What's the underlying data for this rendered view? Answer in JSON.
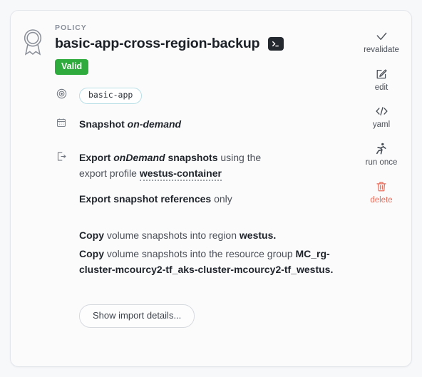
{
  "card": {
    "eyebrow": "POLICY",
    "title": "basic-app-cross-region-backup",
    "terminal_icon": "terminal-icon",
    "award_icon": "award-ribbon-icon",
    "status_badge": {
      "label": "Valid",
      "color": "#2eab3c"
    },
    "target": {
      "icon": "target-icon",
      "chip_label": "basic-app"
    },
    "snapshot": {
      "icon": "calendar-icon",
      "label": "Snapshot",
      "value": "on-demand"
    },
    "export": {
      "icon": "export-icon",
      "line1_a": "Export",
      "line1_b": "onDemand",
      "line1_c": "snapshots",
      "line1_d": "using the",
      "line2_a": "export profile",
      "line2_b": "westus-container",
      "line3_a": "Export snapshot references",
      "line3_b": "only"
    },
    "copy": [
      {
        "verb": "Copy",
        "mid": "volume snapshots into region",
        "target": "westus",
        "period": "."
      },
      {
        "verb": "Copy",
        "mid": "volume snapshots into the resource group",
        "target": "MC_rg-cluster-mcourcy2-tf_aks-cluster-mcourcy2-tf_westus",
        "period": "."
      }
    ],
    "footer": {
      "import_details_label": "Show import details..."
    }
  },
  "actions": [
    {
      "name": "revalidate",
      "label": "revalidate",
      "icon": "check-icon",
      "color": "#474d55"
    },
    {
      "name": "edit",
      "label": "edit",
      "icon": "pencil-square-icon",
      "color": "#474d55"
    },
    {
      "name": "yaml",
      "label": "yaml",
      "icon": "code-icon",
      "color": "#474d55"
    },
    {
      "name": "run-once",
      "label": "run once",
      "icon": "runner-icon",
      "color": "#474d55"
    },
    {
      "name": "delete",
      "label": "delete",
      "icon": "trash-icon",
      "color": "#e8705f"
    }
  ]
}
